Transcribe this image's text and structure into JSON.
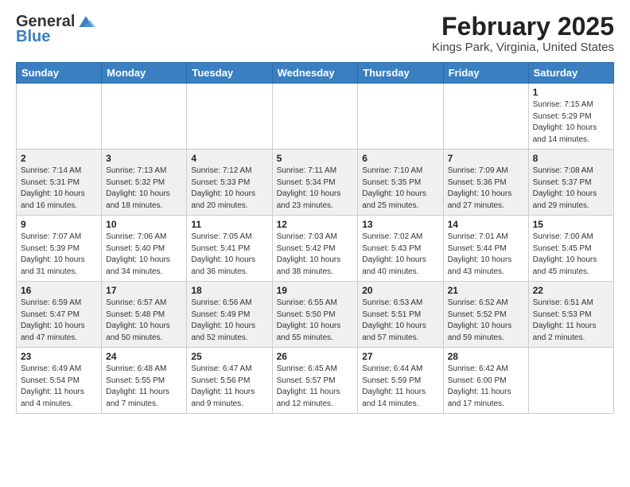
{
  "header": {
    "logo_general": "General",
    "logo_blue": "Blue",
    "title": "February 2025",
    "subtitle": "Kings Park, Virginia, United States"
  },
  "days_of_week": [
    "Sunday",
    "Monday",
    "Tuesday",
    "Wednesday",
    "Thursday",
    "Friday",
    "Saturday"
  ],
  "weeks": [
    [
      {
        "day": "",
        "info": ""
      },
      {
        "day": "",
        "info": ""
      },
      {
        "day": "",
        "info": ""
      },
      {
        "day": "",
        "info": ""
      },
      {
        "day": "",
        "info": ""
      },
      {
        "day": "",
        "info": ""
      },
      {
        "day": "1",
        "info": "Sunrise: 7:15 AM\nSunset: 5:29 PM\nDaylight: 10 hours and 14 minutes."
      }
    ],
    [
      {
        "day": "2",
        "info": "Sunrise: 7:14 AM\nSunset: 5:31 PM\nDaylight: 10 hours and 16 minutes."
      },
      {
        "day": "3",
        "info": "Sunrise: 7:13 AM\nSunset: 5:32 PM\nDaylight: 10 hours and 18 minutes."
      },
      {
        "day": "4",
        "info": "Sunrise: 7:12 AM\nSunset: 5:33 PM\nDaylight: 10 hours and 20 minutes."
      },
      {
        "day": "5",
        "info": "Sunrise: 7:11 AM\nSunset: 5:34 PM\nDaylight: 10 hours and 23 minutes."
      },
      {
        "day": "6",
        "info": "Sunrise: 7:10 AM\nSunset: 5:35 PM\nDaylight: 10 hours and 25 minutes."
      },
      {
        "day": "7",
        "info": "Sunrise: 7:09 AM\nSunset: 5:36 PM\nDaylight: 10 hours and 27 minutes."
      },
      {
        "day": "8",
        "info": "Sunrise: 7:08 AM\nSunset: 5:37 PM\nDaylight: 10 hours and 29 minutes."
      }
    ],
    [
      {
        "day": "9",
        "info": "Sunrise: 7:07 AM\nSunset: 5:39 PM\nDaylight: 10 hours and 31 minutes."
      },
      {
        "day": "10",
        "info": "Sunrise: 7:06 AM\nSunset: 5:40 PM\nDaylight: 10 hours and 34 minutes."
      },
      {
        "day": "11",
        "info": "Sunrise: 7:05 AM\nSunset: 5:41 PM\nDaylight: 10 hours and 36 minutes."
      },
      {
        "day": "12",
        "info": "Sunrise: 7:03 AM\nSunset: 5:42 PM\nDaylight: 10 hours and 38 minutes."
      },
      {
        "day": "13",
        "info": "Sunrise: 7:02 AM\nSunset: 5:43 PM\nDaylight: 10 hours and 40 minutes."
      },
      {
        "day": "14",
        "info": "Sunrise: 7:01 AM\nSunset: 5:44 PM\nDaylight: 10 hours and 43 minutes."
      },
      {
        "day": "15",
        "info": "Sunrise: 7:00 AM\nSunset: 5:45 PM\nDaylight: 10 hours and 45 minutes."
      }
    ],
    [
      {
        "day": "16",
        "info": "Sunrise: 6:59 AM\nSunset: 5:47 PM\nDaylight: 10 hours and 47 minutes."
      },
      {
        "day": "17",
        "info": "Sunrise: 6:57 AM\nSunset: 5:48 PM\nDaylight: 10 hours and 50 minutes."
      },
      {
        "day": "18",
        "info": "Sunrise: 6:56 AM\nSunset: 5:49 PM\nDaylight: 10 hours and 52 minutes."
      },
      {
        "day": "19",
        "info": "Sunrise: 6:55 AM\nSunset: 5:50 PM\nDaylight: 10 hours and 55 minutes."
      },
      {
        "day": "20",
        "info": "Sunrise: 6:53 AM\nSunset: 5:51 PM\nDaylight: 10 hours and 57 minutes."
      },
      {
        "day": "21",
        "info": "Sunrise: 6:52 AM\nSunset: 5:52 PM\nDaylight: 10 hours and 59 minutes."
      },
      {
        "day": "22",
        "info": "Sunrise: 6:51 AM\nSunset: 5:53 PM\nDaylight: 11 hours and 2 minutes."
      }
    ],
    [
      {
        "day": "23",
        "info": "Sunrise: 6:49 AM\nSunset: 5:54 PM\nDaylight: 11 hours and 4 minutes."
      },
      {
        "day": "24",
        "info": "Sunrise: 6:48 AM\nSunset: 5:55 PM\nDaylight: 11 hours and 7 minutes."
      },
      {
        "day": "25",
        "info": "Sunrise: 6:47 AM\nSunset: 5:56 PM\nDaylight: 11 hours and 9 minutes."
      },
      {
        "day": "26",
        "info": "Sunrise: 6:45 AM\nSunset: 5:57 PM\nDaylight: 11 hours and 12 minutes."
      },
      {
        "day": "27",
        "info": "Sunrise: 6:44 AM\nSunset: 5:59 PM\nDaylight: 11 hours and 14 minutes."
      },
      {
        "day": "28",
        "info": "Sunrise: 6:42 AM\nSunset: 6:00 PM\nDaylight: 11 hours and 17 minutes."
      },
      {
        "day": "",
        "info": ""
      }
    ]
  ]
}
